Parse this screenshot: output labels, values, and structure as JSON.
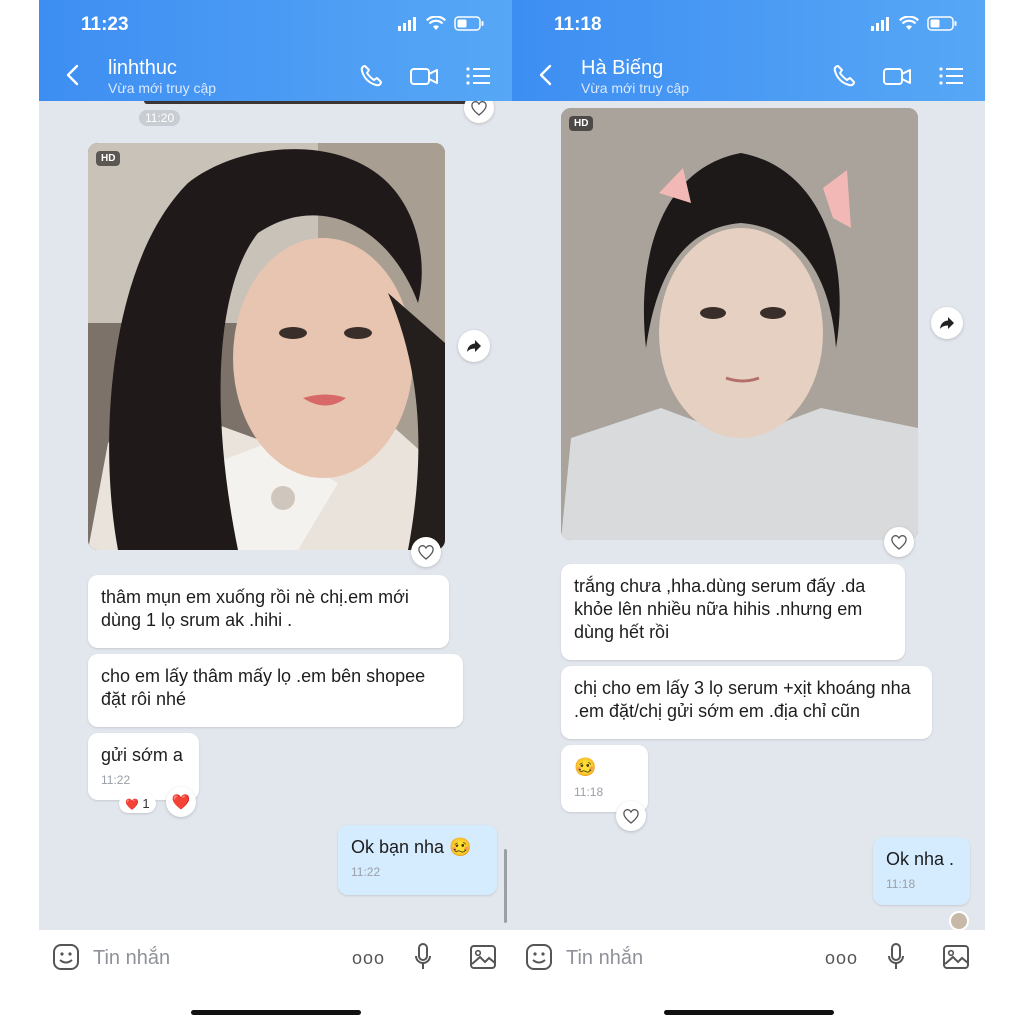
{
  "left": {
    "time": "11:23",
    "contact_name": "linhthuc",
    "contact_status": "Vừa mới truy cập",
    "photo_badge": "HD",
    "earlier_time": "11:20",
    "messages": [
      {
        "text": "thâm mụn em xuống rồi nè chị.em mới dùng 1 lọ srum ak .hihi ."
      },
      {
        "text": "cho em lấy thâm mấy lọ .em bên shopee đặt rôi nhé"
      },
      {
        "text": "gửi sớm a",
        "time": "11:22"
      }
    ],
    "reaction": {
      "emoji": "❤️",
      "count": "1"
    },
    "reaction_button": "❤️",
    "outgoing": {
      "text": "Ok bạn nha",
      "emoji": "🥴",
      "time": "11:22"
    },
    "composer_placeholder": "Tin nhắn",
    "more_label": "ooo"
  },
  "right": {
    "time": "11:18",
    "contact_name": "Hà Biếng",
    "contact_status": "Vừa mới truy cập",
    "photo_badge": "HD",
    "messages": [
      {
        "text": "trắng chưa ,hha.dùng serum đấy .da khỏe lên nhiều nữa hihis .nhưng em dùng hết rồi"
      },
      {
        "text": "chị cho em lấy 3 lọ serum +xịt khoáng nha .em đặt/chị gửi sớm em .địa chỉ cũn"
      },
      {
        "emoji": "🥴",
        "time": "11:18"
      }
    ],
    "outgoing": {
      "text": "Ok nha .",
      "time": "11:18"
    },
    "composer_placeholder": "Tin nhắn",
    "more_label": "ooo"
  },
  "colors": {
    "header_start": "#3d8ef2",
    "header_end": "#57a7f6",
    "chat_background": "#e2e6ed",
    "outgoing_bubble": "#d5ecfe",
    "incoming_bubble": "#ffffff",
    "reaction_red": "#e8202d"
  },
  "icons": [
    "signal-icon",
    "wifi-icon",
    "battery-icon",
    "back-icon",
    "phone-icon",
    "video-icon",
    "menu-icon",
    "heart-icon",
    "share-icon",
    "sticker-icon",
    "microphone-icon",
    "image-icon"
  ]
}
